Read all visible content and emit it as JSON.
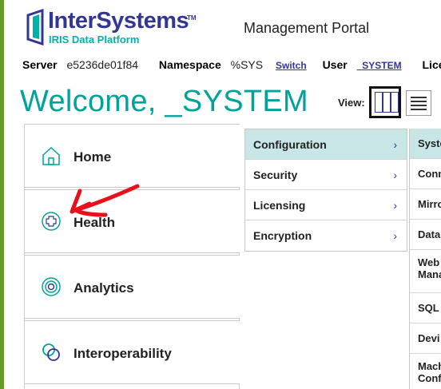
{
  "header": {
    "logo_text": "InterSystems",
    "logo_tm": "TM",
    "logo_subtitle": "IRIS Data Platform",
    "portal_title": "Management Portal"
  },
  "info_bar": {
    "server_label": "Server",
    "server_value": "e5236de01f84",
    "namespace_label": "Namespace",
    "namespace_value": "%SYS",
    "switch_link": "Switch",
    "user_label": "User",
    "user_value": "_SYSTEM",
    "license_label": "License"
  },
  "welcome": "Welcome, _SYSTEM",
  "view": {
    "label": "View:"
  },
  "nav": {
    "items": [
      {
        "label": "Home",
        "icon": "home-icon"
      },
      {
        "label": "Health",
        "icon": "health-icon"
      },
      {
        "label": "Analytics",
        "icon": "analytics-icon"
      },
      {
        "label": "Interoperability",
        "icon": "interoperability-icon"
      }
    ]
  },
  "menu": {
    "items": [
      {
        "label": "Configuration",
        "chevron": "›",
        "active": true
      },
      {
        "label": "Security",
        "chevron": "›",
        "active": false
      },
      {
        "label": "Licensing",
        "chevron": "›",
        "active": false
      },
      {
        "label": "Encryption",
        "chevron": "›",
        "active": false
      }
    ]
  },
  "submenu": {
    "items": [
      {
        "label": "System"
      },
      {
        "label": "Conn"
      },
      {
        "label": "Mirro"
      },
      {
        "label": "Datab"
      },
      {
        "label": "Web Mana"
      },
      {
        "label": "SQL"
      },
      {
        "label": "Devi"
      },
      {
        "label": "Mach Conf"
      }
    ]
  },
  "colors": {
    "brand_navy": "#333695",
    "brand_teal": "#00a39a",
    "active_row": "#c8e6e6",
    "annotation_arrow": "#e8101b"
  }
}
